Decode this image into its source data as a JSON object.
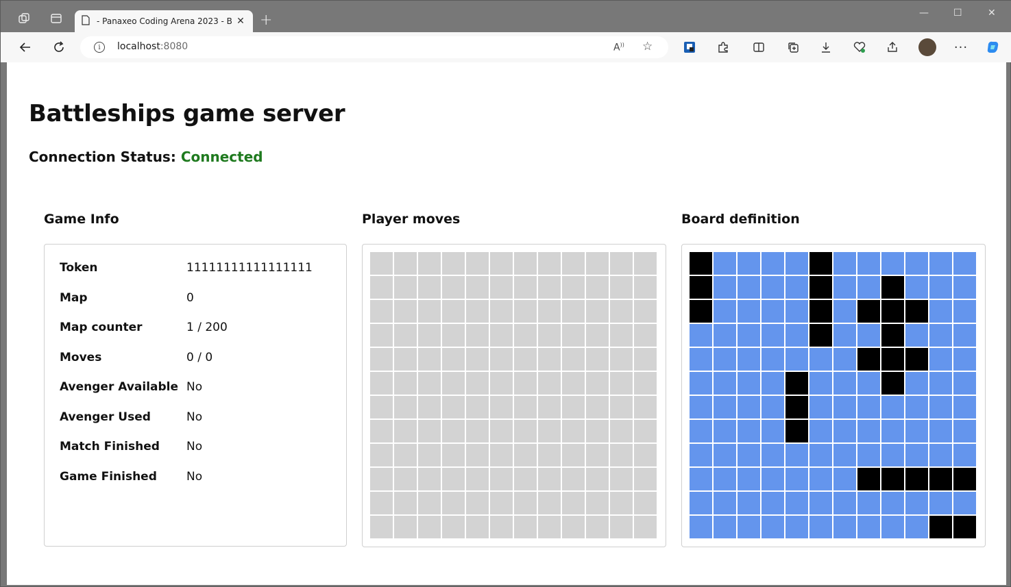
{
  "browser": {
    "tab_title": "- Panaxeo Coding Arena 2023 - B",
    "url_host": "localhost",
    "url_port": ":8080"
  },
  "page": {
    "title": "Battleships game server",
    "status_label": "Connection Status:",
    "status_value": "Connected",
    "status_color": "#1f7a1f"
  },
  "game_info": {
    "title": "Game Info",
    "rows": [
      {
        "key": "Token",
        "value": "11111111111111111"
      },
      {
        "key": "Map",
        "value": "0"
      },
      {
        "key": "Map counter",
        "value": "1 / 200"
      },
      {
        "key": "Moves",
        "value": "0 / 0"
      },
      {
        "key": "Avenger Available",
        "value": "No"
      },
      {
        "key": "Avenger Used",
        "value": "No"
      },
      {
        "key": "Match Finished",
        "value": "No"
      },
      {
        "key": "Game Finished",
        "value": "No"
      }
    ]
  },
  "player_moves": {
    "title": "Player moves",
    "rows": [
      "************",
      "************",
      "************",
      "************",
      "************",
      "************",
      "************",
      "************",
      "************",
      "************",
      "************",
      "************"
    ]
  },
  "board_definition": {
    "title": "Board definition",
    "rows": [
      "X....X......",
      "X....X..X...",
      "X....X.XXX..",
      ".....X..X...",
      ".......XXX..",
      "....X...X...",
      "....X.......",
      "....X.......",
      "............",
      ".......XXXXX",
      "............",
      "..........XX"
    ]
  },
  "colors": {
    "unknown": "#d3d3d3",
    "water": "#6495ed",
    "ship": "#000000"
  }
}
